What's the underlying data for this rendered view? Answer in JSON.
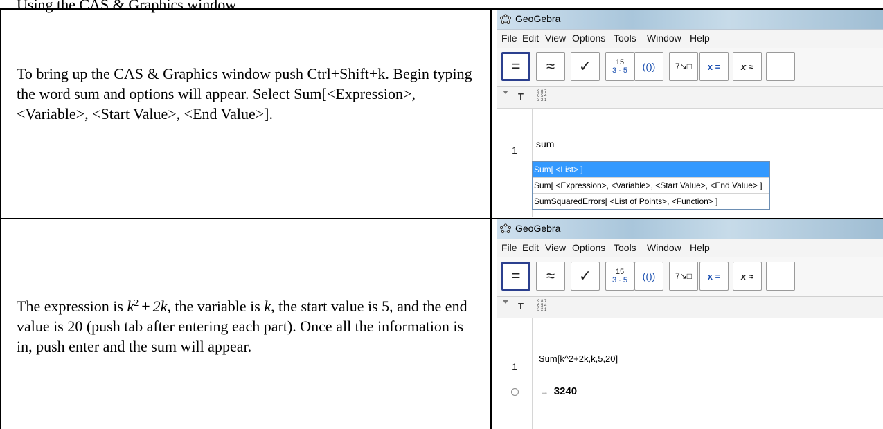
{
  "header_fragment": "Using the CAS & Graphics window",
  "rows": [
    {
      "text": "To bring up the CAS & Graphics window push Ctrl+Shift+k.  Begin typing the word sum and options will appear.  Select Sum[<Expression>, <Variable>, <Start Value>, <End Value>]."
    },
    {
      "text_before": "The expression is ",
      "math": {
        "base": "k",
        "exp": "2",
        "plus": "+",
        "term": "2k"
      },
      "text_mid": ", the variable is ",
      "var": "k",
      "text_after": ", the start value is 5, and the end value is 20 (push tab after entering each part).  Once all the information is in, push enter and the sum will appear."
    }
  ],
  "ggb": {
    "title": "GeoGebra",
    "menu": [
      "File",
      "Edit",
      "View",
      "Options",
      "Tools",
      "Window",
      "Help"
    ],
    "toolbar_icons": [
      "equals-icon",
      "approx-icon",
      "check-icon",
      "factor-icon",
      "expand-icon",
      "substitute-icon",
      "solve-icon",
      "nsolve-icon"
    ],
    "toolbar_labels": {
      "equals": "=",
      "approx": "≈",
      "check": "✓",
      "factor_top": "15",
      "factor_bottom": "3 · 5",
      "expand": "(())",
      "subst": "7↘□",
      "solve": "x =",
      "nsolve": "x ≈"
    },
    "style_t": "T",
    "style_digits": "9 8 7 6 5 4 3 2 1",
    "screen1": {
      "row_number": "1",
      "input": "sum",
      "suggestions": [
        "Sum[ <List> ]",
        "Sum[ <Expression>, <Variable>, <Start Value>, <End Value> ]",
        "SumSquaredErrors[ <List of Points>, <Function> ]"
      ]
    },
    "screen2": {
      "row_number": "1",
      "input": "Sum[k^2+2k,k,5,20]",
      "arrow": "→",
      "result": "3240"
    }
  }
}
